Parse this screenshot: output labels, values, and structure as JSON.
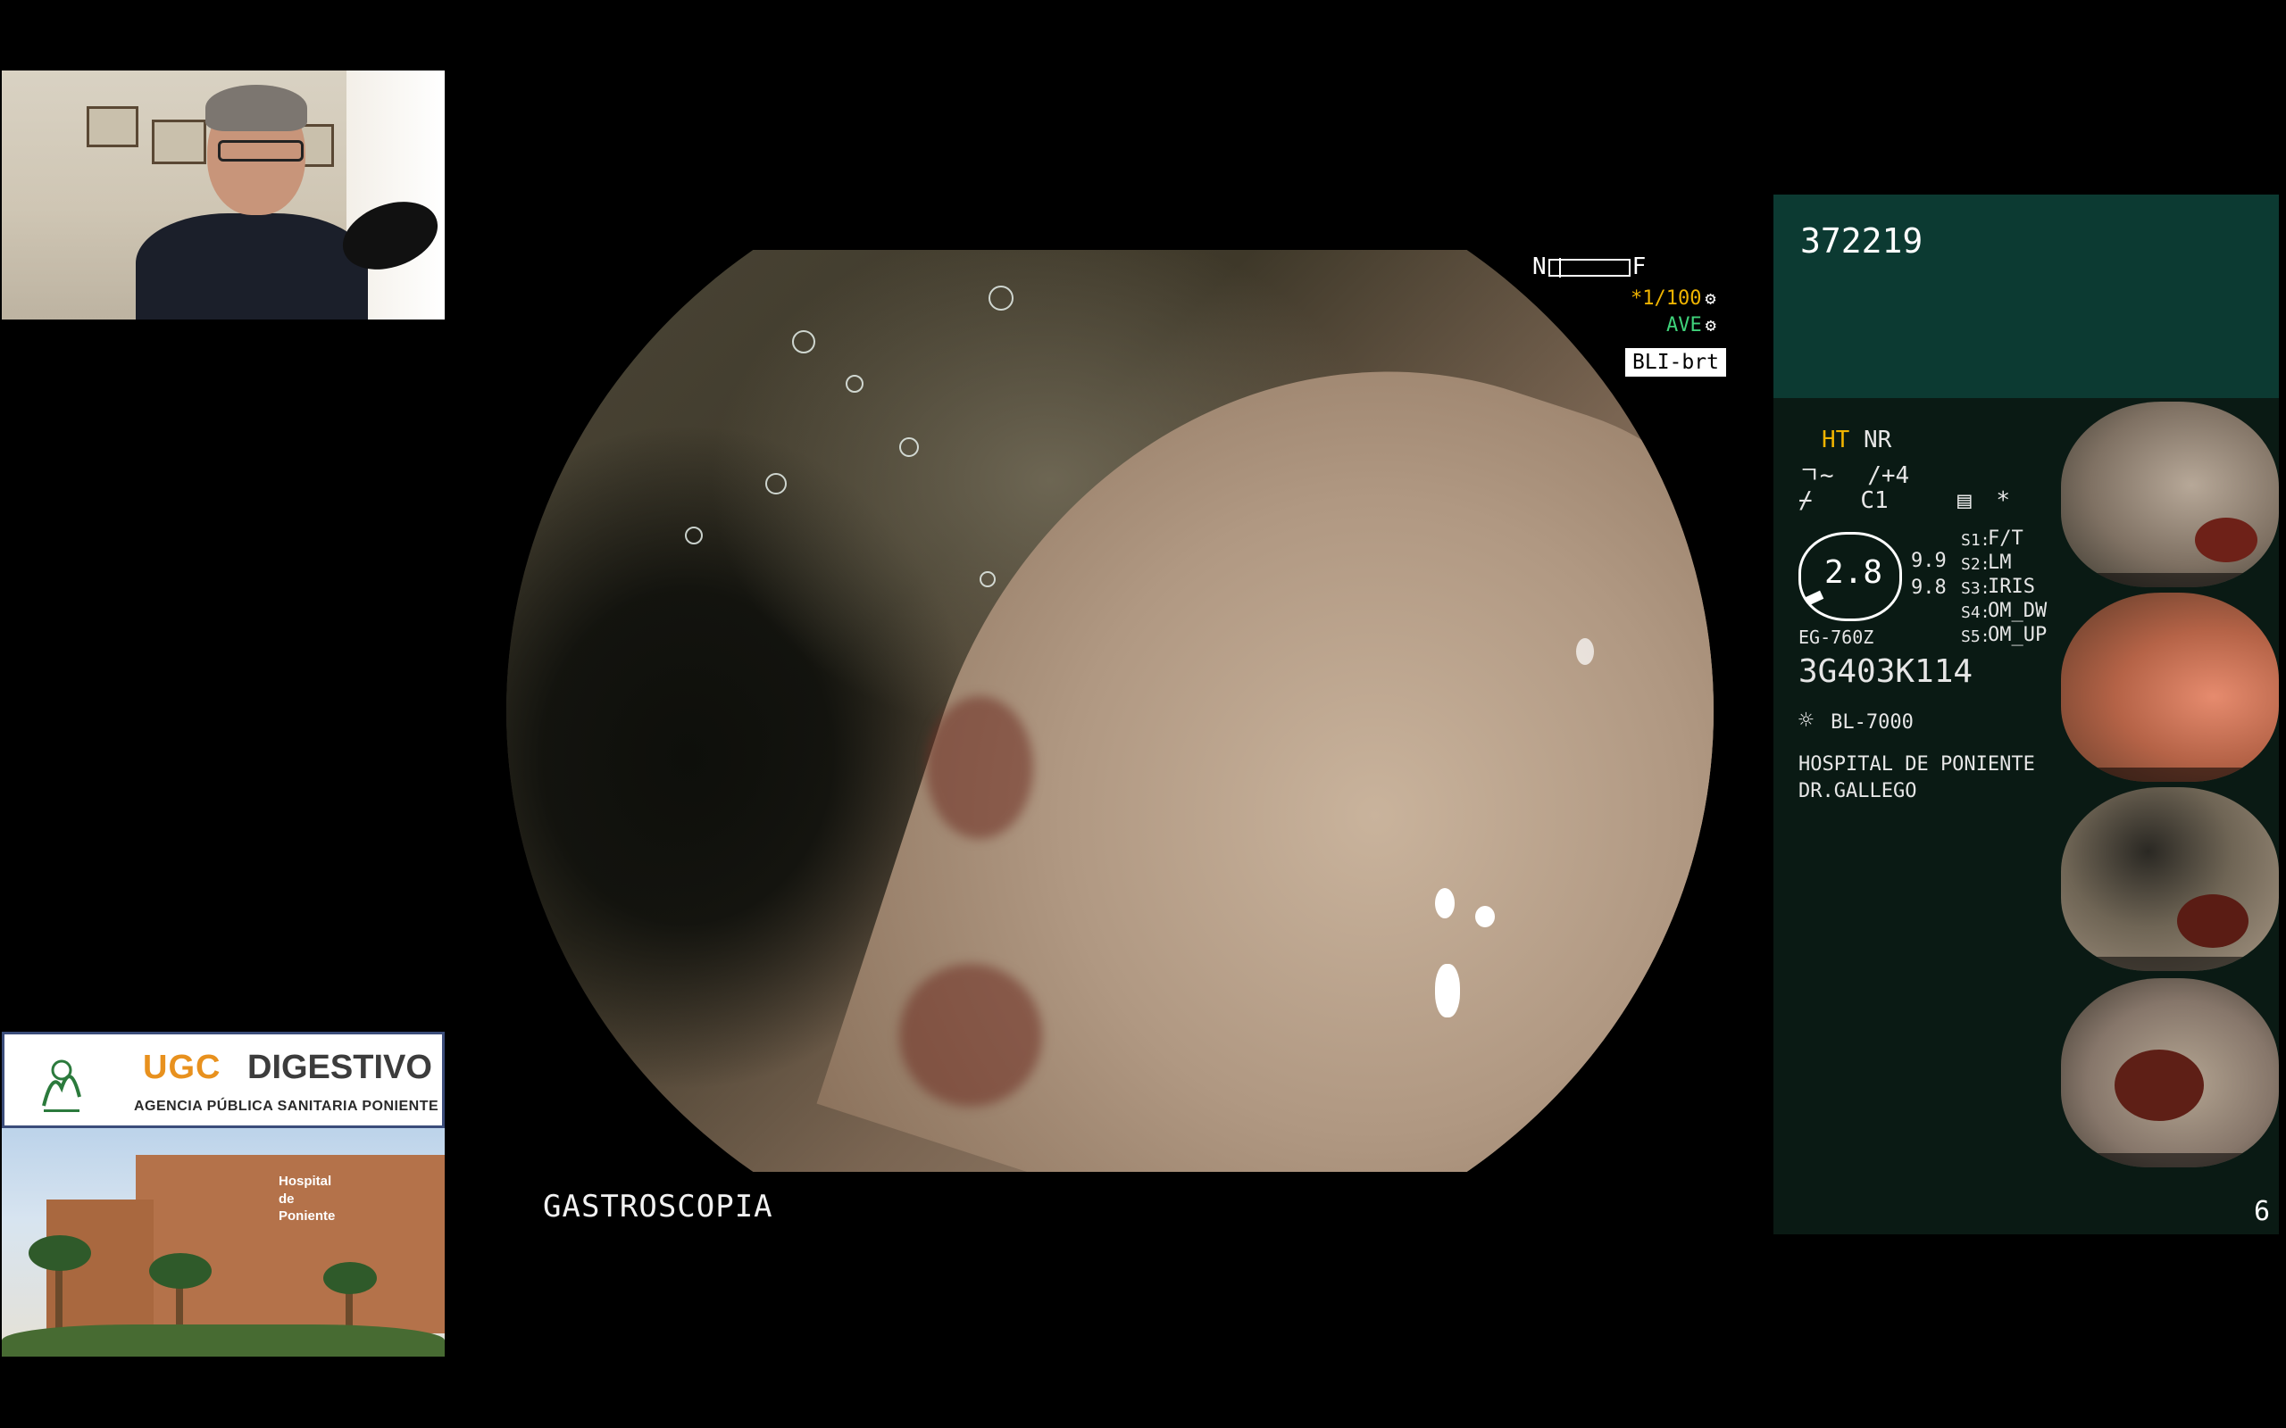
{
  "endoscope": {
    "nf_left": "N",
    "nf_right": "F",
    "shutter": "*1/100",
    "ave": "AVE",
    "bli_mode": "BLI-brt",
    "exam_label": "GASTROSCOPIA"
  },
  "panel": {
    "patient_id": "372219",
    "ht_label": "HT",
    "ht_value": "NR",
    "enhance_value": "/+4",
    "color_value": "C1",
    "star_symbol": "*",
    "gauge_value": "2.8",
    "gauge_sub1": "9.9",
    "gauge_sub2": "9.8",
    "scope_model": "EG-760Z",
    "scope_serial": "3G403K114",
    "light_source": "BL-7000",
    "hospital": "HOSPITAL DE PONIENTE",
    "doctor": "DR.GALLEGO",
    "s_labels": [
      "S1:",
      "S2:",
      "S3:",
      "S4:",
      "S5:"
    ],
    "s_values": [
      "F/T",
      "LM",
      "IRIS",
      "OM_DW",
      "OM_UP"
    ],
    "page_number": "6"
  },
  "logo": {
    "ugc": "UGC",
    "digestivo": "DIGESTIVO",
    "agency": "AGENCIA PÚBLICA SANITARIA PONIENTE"
  },
  "hospital_sign": {
    "line1": "Hospital",
    "line2": "de",
    "line3": "Poniente"
  },
  "colors": {
    "background": "#000000",
    "panel_bg": "#0a1a14",
    "panel_top": "#0c3a32",
    "accent_yellow": "#f0b400",
    "accent_green": "#3fd27a",
    "ugc_orange": "#e8911e"
  },
  "icons": [
    "gear-icon",
    "hue-icon",
    "sharpness-icon",
    "color-mode-icon",
    "grid-icon",
    "light-source-icon"
  ]
}
